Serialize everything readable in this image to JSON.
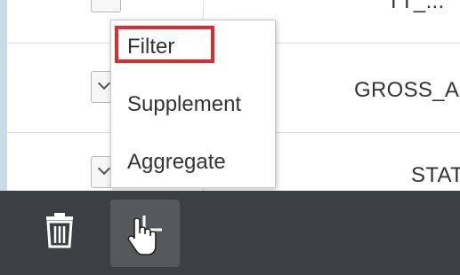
{
  "grid": {
    "rows": [
      {
        "value": "TT_..."
      },
      {
        "value": "GROSS_A"
      },
      {
        "value": "STAT"
      }
    ]
  },
  "menu": {
    "items": [
      {
        "label": "Filter"
      },
      {
        "label": "Supplement"
      },
      {
        "label": "Aggregate"
      }
    ],
    "highlighted_index": 0,
    "highlight_color": "#e02b2b"
  },
  "toolbar": {
    "icons": [
      "trash-icon",
      "pointer-hand-icon"
    ],
    "background": "#3c4043"
  }
}
